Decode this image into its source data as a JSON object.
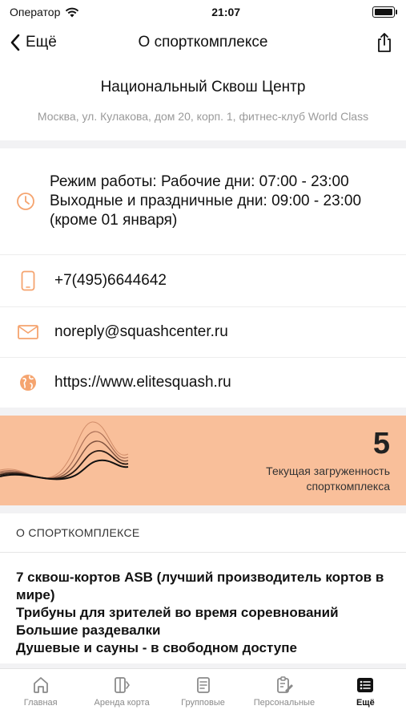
{
  "status_bar": {
    "carrier": "Оператор",
    "time": "21:07"
  },
  "nav": {
    "back_label": "Ещё",
    "title": "О спорткомплексе"
  },
  "club": {
    "name": "Национальный Сквош Центр",
    "address": "Москва, ул. Кулакова, дом 20, корп. 1, фитнес-клуб World Class"
  },
  "contacts": {
    "hours_line1": "Режим работы: Рабочие дни: 07:00 - 23:00",
    "hours_line2": "Выходные и праздничные дни: 09:00 - 23:00 (кроме 01 января)",
    "phone": "+7(495)6644642",
    "email": "noreply@squashcenter.ru",
    "website": "https://www.elitesquash.ru"
  },
  "load": {
    "value": "5",
    "caption": "Текущая загруженность спорткомплекса"
  },
  "about": {
    "section_title": "О СПОРТКОМПЛЕКСЕ",
    "lines": [
      "7 сквош-кортов ASB (лучший производитель кортов в мире)",
      "Трибуны для зрителей во время соревнований",
      "Большие раздевалки",
      "Душевые и сауны - в свободном доступе"
    ]
  },
  "tabs": [
    {
      "label": "Главная",
      "icon": "home-icon"
    },
    {
      "label": "Аренда корта",
      "icon": "court-icon"
    },
    {
      "label": "Групповые",
      "icon": "document-icon"
    },
    {
      "label": "Персональные",
      "icon": "clipboard-edit-icon"
    },
    {
      "label": "Ещё",
      "icon": "list-icon"
    }
  ],
  "colors": {
    "accent": "#f5a46f",
    "banner": "#f9bf9a"
  }
}
